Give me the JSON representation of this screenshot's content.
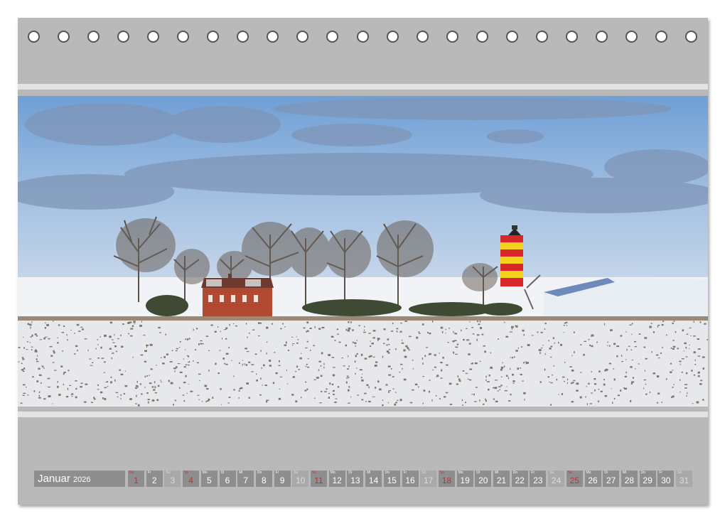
{
  "calendar": {
    "month": "Januar",
    "year": "2026",
    "days": [
      {
        "wd": "Do",
        "n": "1",
        "type": "holiday"
      },
      {
        "wd": "Fr",
        "n": "2",
        "type": "normal"
      },
      {
        "wd": "Sa",
        "n": "3",
        "type": "weekend"
      },
      {
        "wd": "So",
        "n": "4",
        "type": "holiday"
      },
      {
        "wd": "Mo",
        "n": "5",
        "type": "normal"
      },
      {
        "wd": "Di",
        "n": "6",
        "type": "normal"
      },
      {
        "wd": "Mi",
        "n": "7",
        "type": "normal"
      },
      {
        "wd": "Do",
        "n": "8",
        "type": "normal"
      },
      {
        "wd": "Fr",
        "n": "9",
        "type": "normal"
      },
      {
        "wd": "Sa",
        "n": "10",
        "type": "weekend"
      },
      {
        "wd": "So",
        "n": "11",
        "type": "holiday"
      },
      {
        "wd": "Mo",
        "n": "12",
        "type": "normal"
      },
      {
        "wd": "Di",
        "n": "13",
        "type": "normal"
      },
      {
        "wd": "Mi",
        "n": "14",
        "type": "normal"
      },
      {
        "wd": "Do",
        "n": "15",
        "type": "normal"
      },
      {
        "wd": "Fr",
        "n": "16",
        "type": "normal"
      },
      {
        "wd": "Sa",
        "n": "17",
        "type": "weekend"
      },
      {
        "wd": "So",
        "n": "18",
        "type": "holiday"
      },
      {
        "wd": "Mo",
        "n": "19",
        "type": "normal"
      },
      {
        "wd": "Di",
        "n": "20",
        "type": "normal"
      },
      {
        "wd": "Mi",
        "n": "21",
        "type": "normal"
      },
      {
        "wd": "Do",
        "n": "22",
        "type": "normal"
      },
      {
        "wd": "Fr",
        "n": "23",
        "type": "normal"
      },
      {
        "wd": "Sa",
        "n": "24",
        "type": "weekend"
      },
      {
        "wd": "So",
        "n": "25",
        "type": "holiday"
      },
      {
        "wd": "Mo",
        "n": "26",
        "type": "normal"
      },
      {
        "wd": "Di",
        "n": "27",
        "type": "normal"
      },
      {
        "wd": "Mi",
        "n": "28",
        "type": "normal"
      },
      {
        "wd": "Do",
        "n": "29",
        "type": "normal"
      },
      {
        "wd": "Fr",
        "n": "30",
        "type": "normal"
      },
      {
        "wd": "Sa",
        "n": "31",
        "type": "weekend"
      }
    ]
  },
  "binding_holes": 23,
  "photo": {
    "sky_color": "#8fb4dd",
    "snow_color": "#f2f4f8",
    "lighthouse_red": "#d8262a",
    "lighthouse_yellow": "#f2d21c",
    "house_color": "#b04a32"
  }
}
